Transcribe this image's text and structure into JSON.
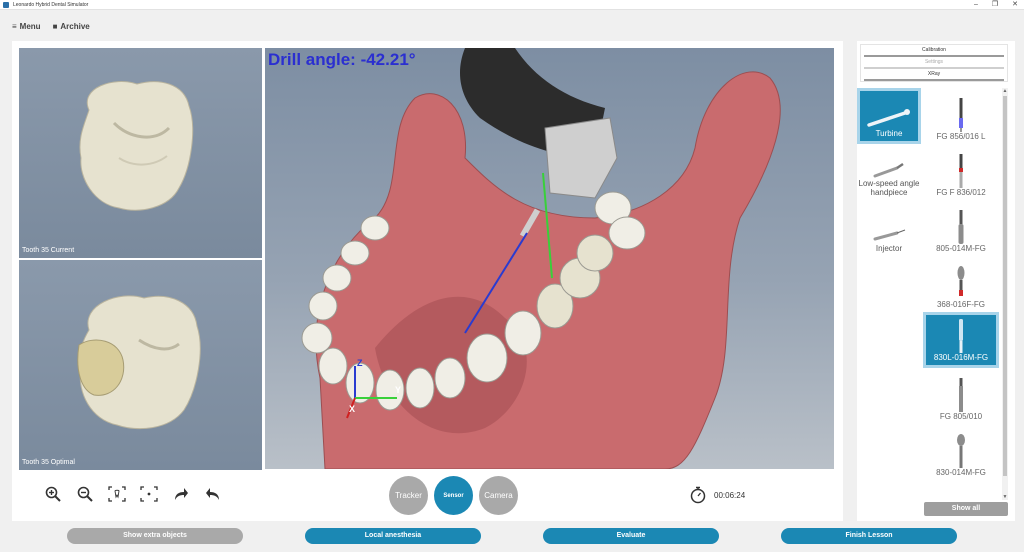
{
  "window": {
    "title": "Leonardo Hybrid Dental Simulator",
    "controls": [
      "–",
      "❐",
      "✕"
    ]
  },
  "menu": {
    "menu_label": "Menu",
    "archive_label": "Archive"
  },
  "views": {
    "current_label": "Tooth 35 Current",
    "optimal_label": "Tooth 35 Optimal",
    "drill_angle": "Drill angle: -42.21°"
  },
  "modes": {
    "tracker": "Tracker",
    "sensor": "Sensor",
    "camera": "Camera"
  },
  "timer": "00:06:24",
  "settings": {
    "calibration": "Calibration",
    "settings": "Settings",
    "xray": "XRay"
  },
  "instruments": [
    {
      "label": "Turbine",
      "selected": true
    },
    {
      "label": "Low-speed angle handpiece",
      "selected": false
    },
    {
      "label": "Injector",
      "selected": false
    }
  ],
  "burs": [
    {
      "label": "FG 856/016 L",
      "selected": false
    },
    {
      "label": "FG F 836/012",
      "selected": false
    },
    {
      "label": "805-014M-FG",
      "selected": false
    },
    {
      "label": "368-016F-FG",
      "selected": false
    },
    {
      "label": "830L-016M-FG",
      "selected": true
    },
    {
      "label": "FG 805/010",
      "selected": false
    },
    {
      "label": "830-014M-FG",
      "selected": false
    }
  ],
  "show_all": "Show all",
  "bottom": {
    "extra": "Show extra objects",
    "anesthesia": "Local anesthesia",
    "evaluate": "Evaluate",
    "finish": "Finish Lesson"
  },
  "colors": {
    "accent": "#1b88b4",
    "gum": "#c96b6e",
    "tooth": "#e6e2cf",
    "angle_text": "#2b2fd0"
  }
}
